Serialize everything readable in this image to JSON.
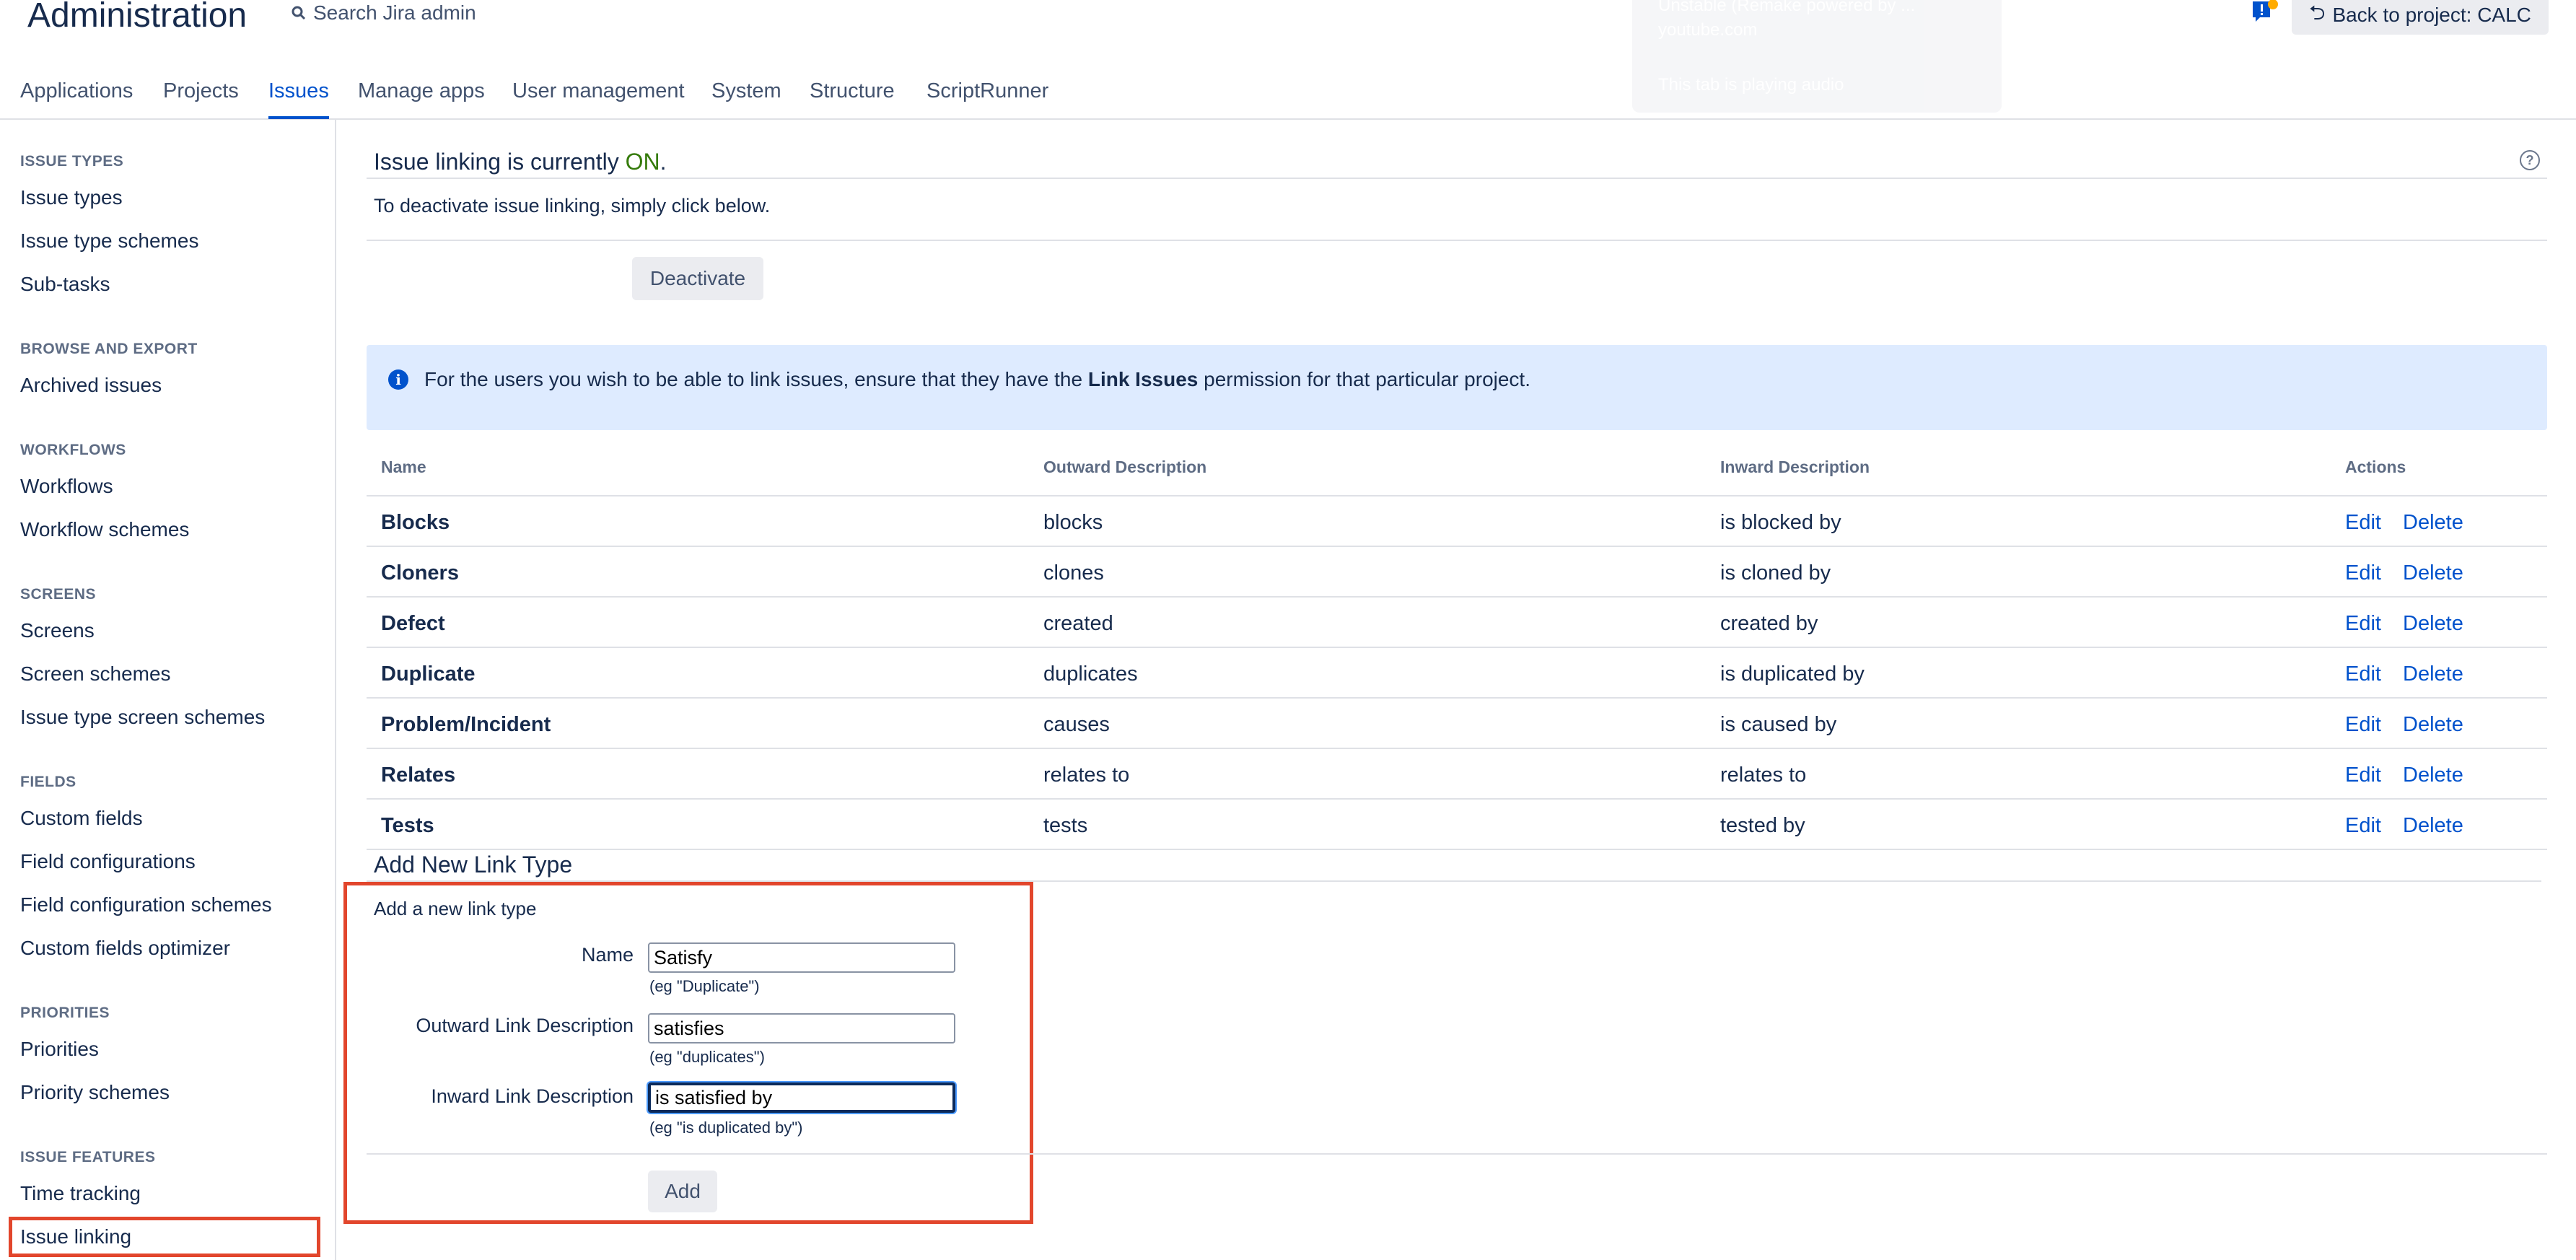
{
  "header": {
    "title": "Administration",
    "search_label": "Search Jira admin",
    "back_button": "Back to project: CALC",
    "tooltip_line1": "Unstable (Remake powered by ...",
    "tooltip_line2": "youtube.com",
    "tooltip_line3": "This tab is playing audio"
  },
  "topnav": {
    "tabs": [
      {
        "label": "Applications"
      },
      {
        "label": "Projects"
      },
      {
        "label": "Issues"
      },
      {
        "label": "Manage apps"
      },
      {
        "label": "User management"
      },
      {
        "label": "System"
      },
      {
        "label": "Structure"
      },
      {
        "label": "ScriptRunner"
      }
    ],
    "active": "Issues"
  },
  "sidebar": {
    "sections": [
      {
        "heading": "ISSUE TYPES",
        "items": [
          "Issue types",
          "Issue type schemes",
          "Sub-tasks"
        ]
      },
      {
        "heading": "BROWSE AND EXPORT",
        "items": [
          "Archived issues"
        ]
      },
      {
        "heading": "WORKFLOWS",
        "items": [
          "Workflows",
          "Workflow schemes"
        ]
      },
      {
        "heading": "SCREENS",
        "items": [
          "Screens",
          "Screen schemes",
          "Issue type screen schemes"
        ]
      },
      {
        "heading": "FIELDS",
        "items": [
          "Custom fields",
          "Field configurations",
          "Field configuration schemes",
          "Custom fields optimizer"
        ]
      },
      {
        "heading": "PRIORITIES",
        "items": [
          "Priorities",
          "Priority schemes"
        ]
      },
      {
        "heading": "ISSUE FEATURES",
        "items": [
          "Time tracking",
          "Issue linking"
        ]
      }
    ],
    "selected": "Issue linking"
  },
  "status": {
    "prefix": "Issue linking is currently ",
    "state": "ON",
    "suffix": ".",
    "state_color": "#357b0b",
    "instruction": "To deactivate issue linking, simply click below.",
    "deactivate_label": "Deactivate"
  },
  "banner": {
    "text_before": "For the users you wish to be able to link issues, ensure that they have the ",
    "text_bold": "Link Issues",
    "text_after": " permission for that particular project."
  },
  "table": {
    "headers": [
      "Name",
      "Outward Description",
      "Inward Description",
      "Actions"
    ],
    "edit_label": "Edit",
    "delete_label": "Delete",
    "rows": [
      {
        "name": "Blocks",
        "outward": "blocks",
        "inward": "is blocked by"
      },
      {
        "name": "Cloners",
        "outward": "clones",
        "inward": "is cloned by"
      },
      {
        "name": "Defect",
        "outward": "created",
        "inward": "created by"
      },
      {
        "name": "Duplicate",
        "outward": "duplicates",
        "inward": "is duplicated by"
      },
      {
        "name": "Problem/Incident",
        "outward": "causes",
        "inward": "is caused by"
      },
      {
        "name": "Relates",
        "outward": "relates to",
        "inward": "relates to"
      },
      {
        "name": "Tests",
        "outward": "tests",
        "inward": "tested by"
      }
    ]
  },
  "add_form": {
    "title": "Add New Link Type",
    "subtitle": "Add a new link type",
    "name_label": "Name",
    "name_value": "Satisfy",
    "name_hint": "(eg \"Duplicate\")",
    "outward_label": "Outward Link Description",
    "outward_value": "satisfies",
    "outward_hint": "(eg \"duplicates\")",
    "inward_label": "Inward Link Description",
    "inward_value": "is satisfied by",
    "inward_hint": "(eg \"is duplicated by\")",
    "add_label": "Add"
  },
  "colors": {
    "accent": "#0052cc",
    "highlight_box": "#e2462c",
    "banner_bg": "#deebff"
  }
}
